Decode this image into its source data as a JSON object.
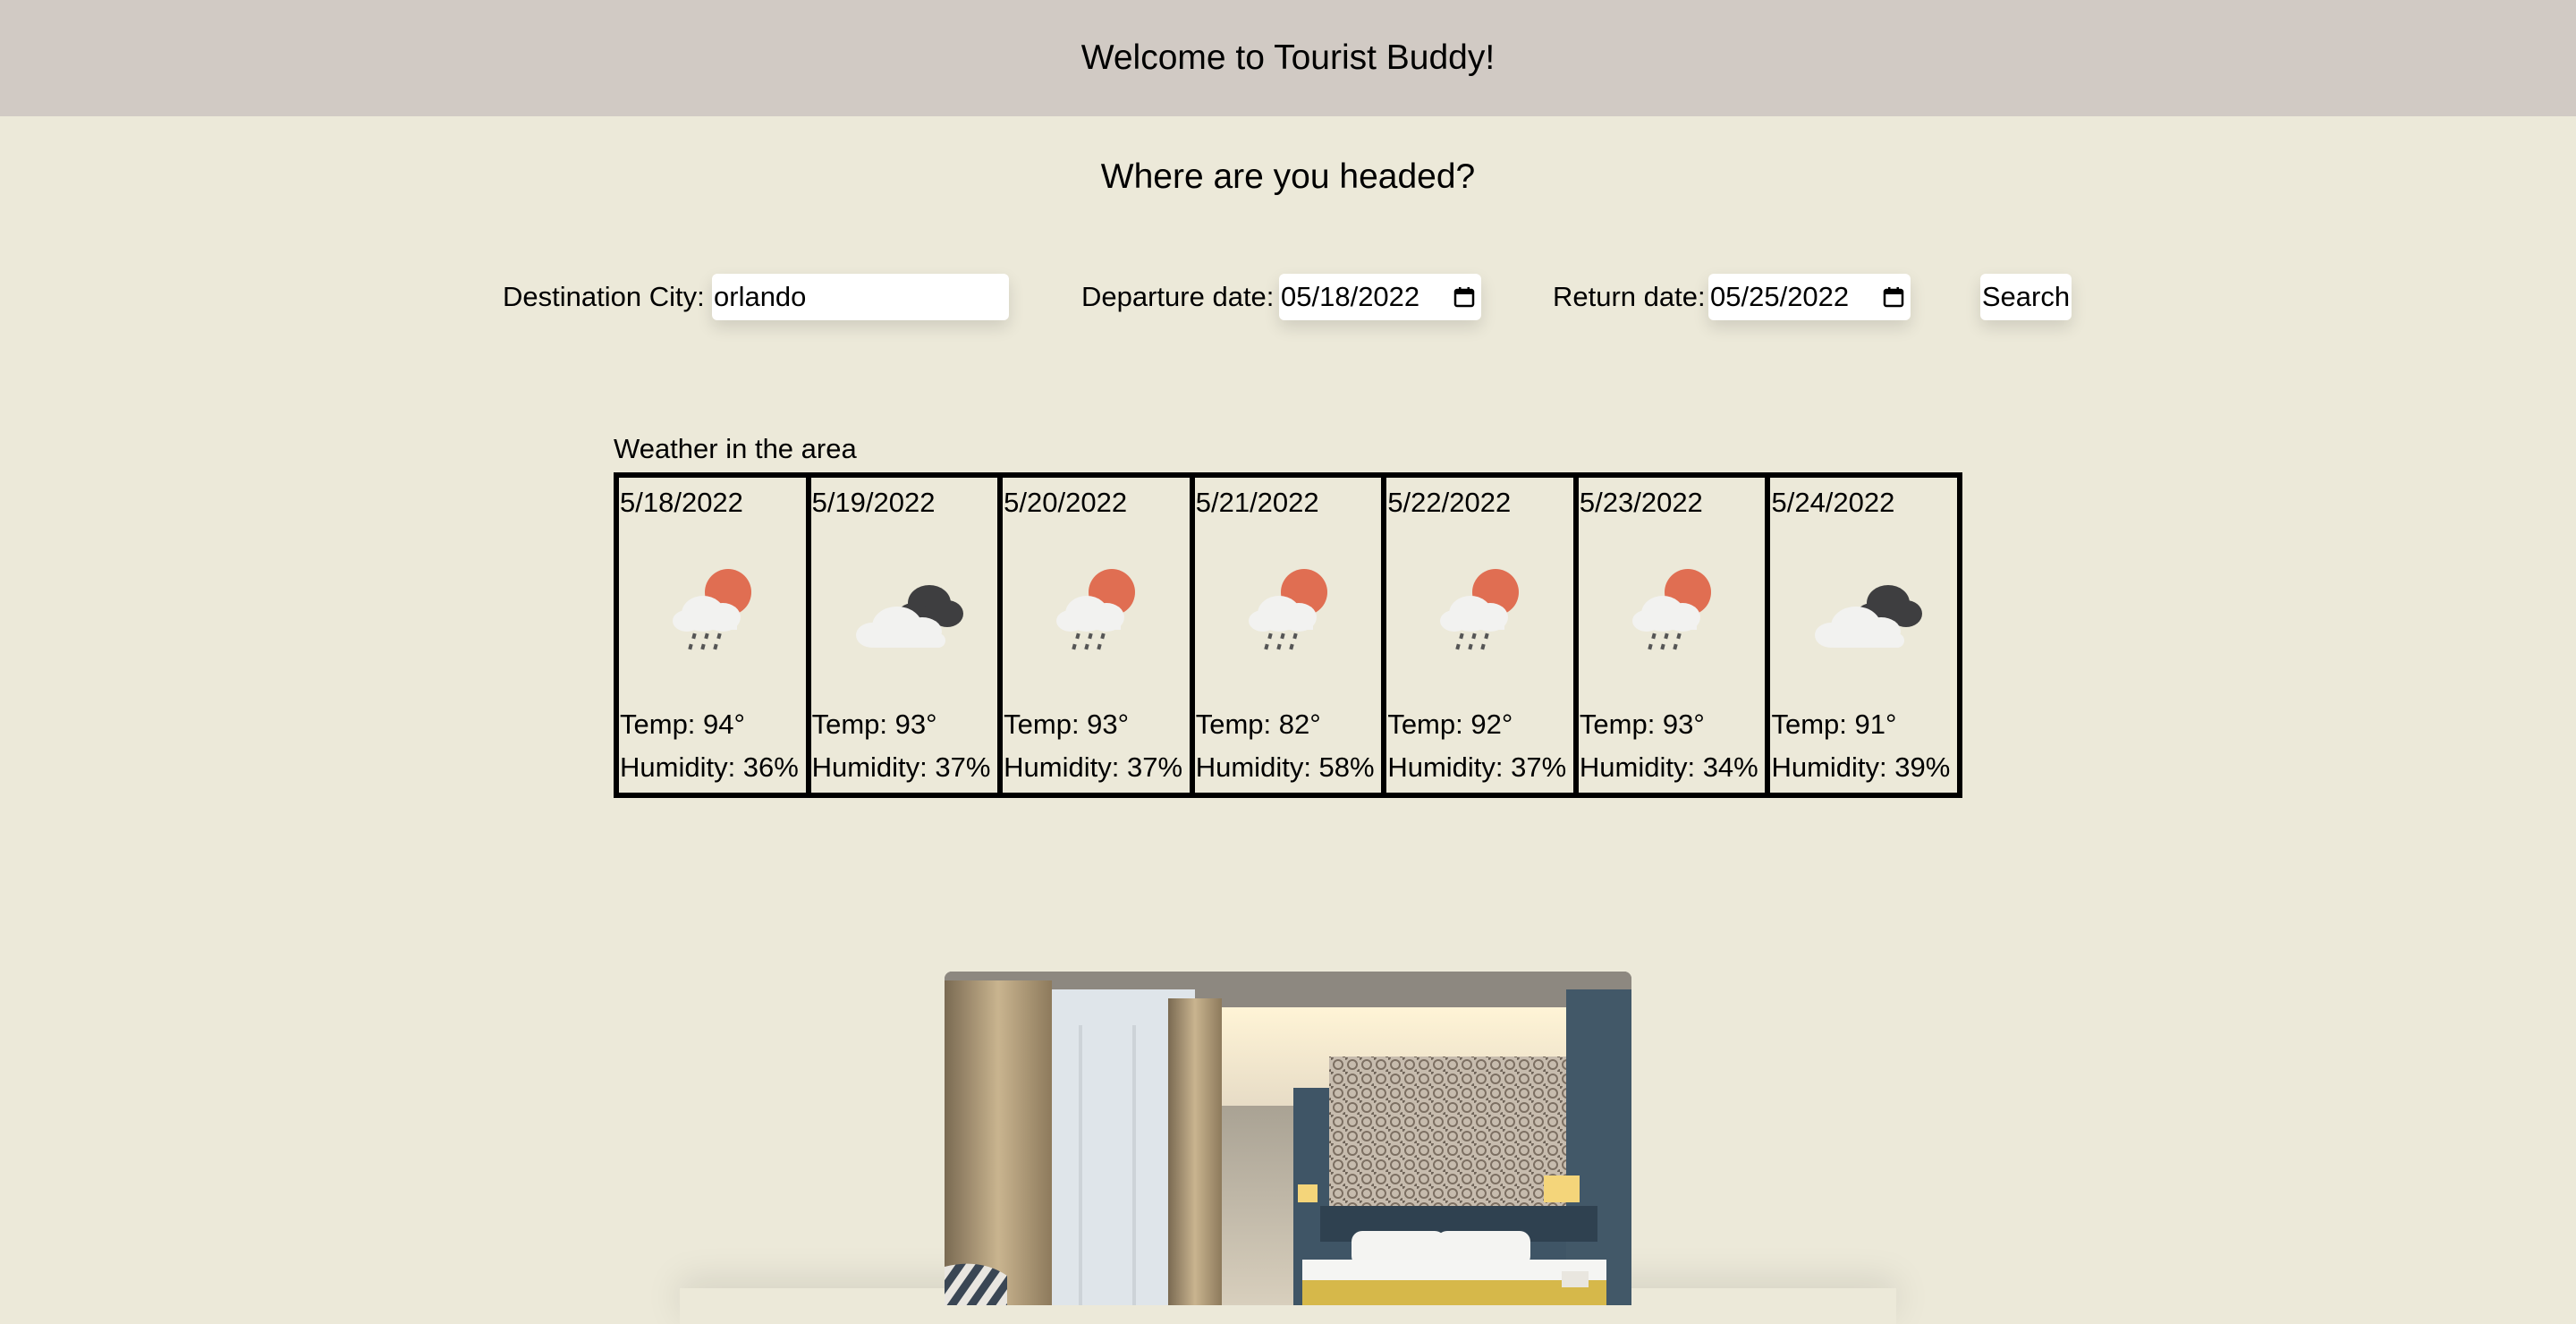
{
  "header": {
    "title": "Welcome to Tourist Buddy!"
  },
  "main": {
    "heading": "Where are you headed?"
  },
  "form": {
    "destination_label": "Destination City:",
    "destination_value": "orlando",
    "departure_label": "Departure date:",
    "departure_value": "05/18/2022",
    "return_label": "Return date:",
    "return_value": "05/25/2022",
    "search_label": "Search"
  },
  "weather": {
    "title": "Weather in the area",
    "days": [
      {
        "date": "5/18/2022",
        "icon": "sun-rain-icon",
        "temp": "Temp: 94°",
        "humidity": "Humidity: 36%"
      },
      {
        "date": "5/19/2022",
        "icon": "cloudy-icon",
        "temp": "Temp: 93°",
        "humidity": "Humidity: 37%"
      },
      {
        "date": "5/20/2022",
        "icon": "sun-rain-icon",
        "temp": "Temp: 93°",
        "humidity": "Humidity: 37%"
      },
      {
        "date": "5/21/2022",
        "icon": "sun-rain-icon",
        "temp": "Temp: 82°",
        "humidity": "Humidity: 58%"
      },
      {
        "date": "5/22/2022",
        "icon": "sun-rain-icon",
        "temp": "Temp: 92°",
        "humidity": "Humidity: 37%"
      },
      {
        "date": "5/23/2022",
        "icon": "sun-rain-icon",
        "temp": "Temp: 93°",
        "humidity": "Humidity: 34%"
      },
      {
        "date": "5/24/2022",
        "icon": "cloudy-icon",
        "temp": "Temp: 91°",
        "humidity": "Humidity: 39%"
      }
    ]
  },
  "colors": {
    "page_bg": "#ece9d9",
    "header_bg": "#d1cac4",
    "sun": "#e06e52",
    "dark_cloud": "#3e3e40",
    "light_cloud": "#f2f2f0"
  }
}
